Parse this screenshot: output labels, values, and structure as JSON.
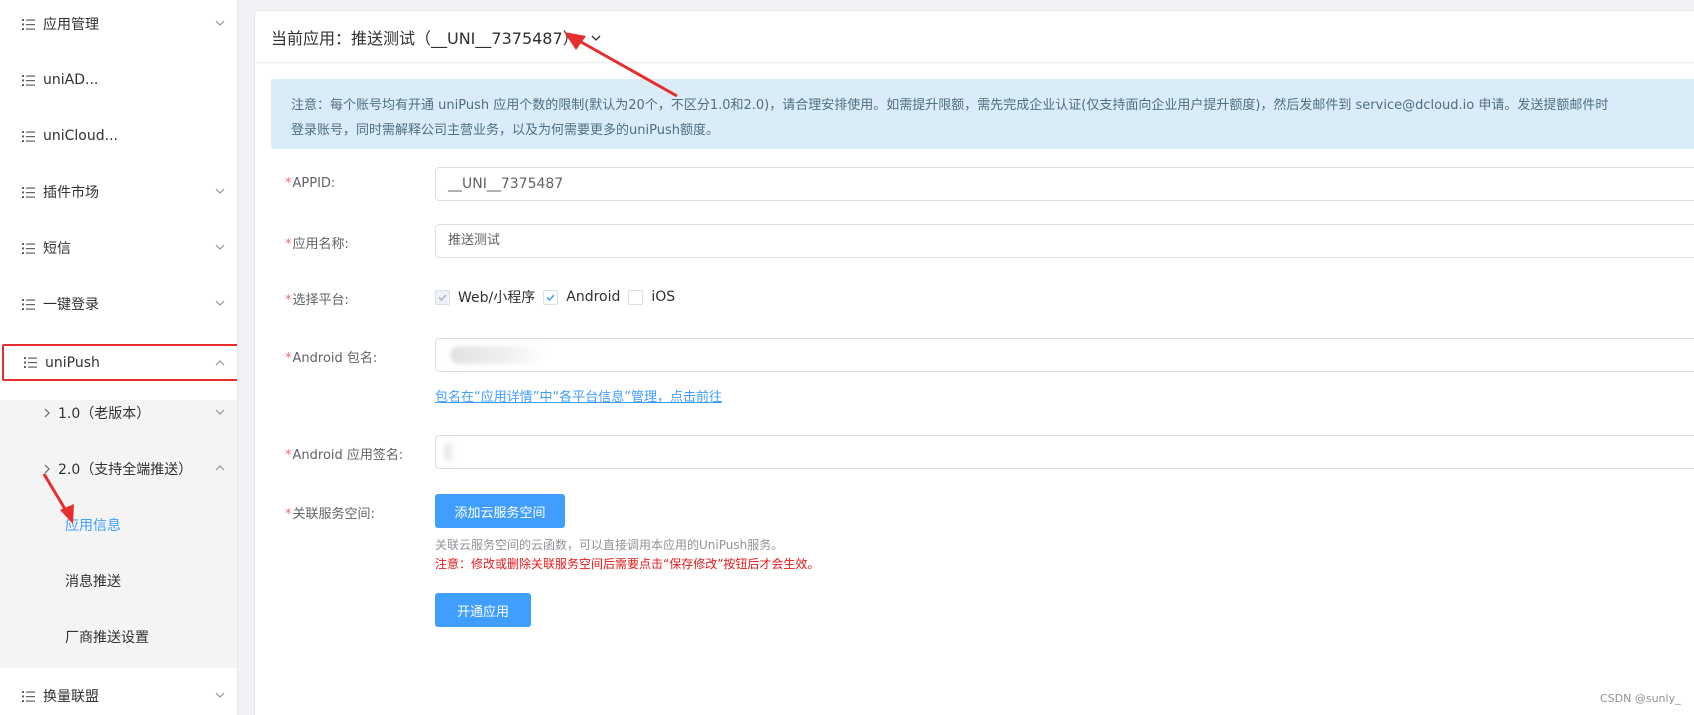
{
  "sidebar": {
    "items": [
      {
        "label": "应用管理"
      },
      {
        "label": "uniAD..."
      },
      {
        "label": "uniCloud..."
      },
      {
        "label": "插件市场"
      },
      {
        "label": "短信"
      },
      {
        "label": "一键登录"
      },
      {
        "label": "uniPush"
      },
      {
        "label": "换量联盟"
      }
    ],
    "subitems": [
      {
        "label": "1.0（老版本）"
      },
      {
        "label": "2.0（支持全端推送）"
      }
    ],
    "leaves": [
      {
        "label": "应用信息"
      },
      {
        "label": "消息推送"
      },
      {
        "label": "厂商推送设置"
      }
    ]
  },
  "header": {
    "title": "当前应用：推送测试（__UNI__7375487）"
  },
  "notice": {
    "line1": "注意：每个账号均有开通 uniPush 应用个数的限制(默认为20个，不区分1.0和2.0)，请合理安排使用。如需提升限额，需先完成企业认证(仅支持面向企业用户提升额度)，然后发邮件到 service@dcloud.io 申请。发送提额邮件时",
    "line2": "登录账号，同时需解释公司主营业务，以及为何需要更多的uniPush额度。"
  },
  "form": {
    "appid_label": "APPID:",
    "appid_value": "__UNI__7375487",
    "name_label": "应用名称:",
    "name_value": "推送测试",
    "platform_label": "选择平台:",
    "platforms": [
      {
        "label": "Web/小程序"
      },
      {
        "label": "Android"
      },
      {
        "label": "iOS"
      }
    ],
    "pkg_label": "Android 包名:",
    "pkg_link": "包名在“应用详情”中“各平台信息”管理，点击前往",
    "sign_label": "Android 应用签名:",
    "space_label": "关联服务空间:",
    "add_space_button": "添加云服务空间",
    "space_hint": "关联云服务空间的云函数，可以直接调用本应用的UniPush服务。",
    "space_warning": "注意：修改或删除关联服务空间后需要点击“保存修改”按钮后才会生效。",
    "open_button": "开通应用",
    "required_mark": "*"
  },
  "watermark": "CSDN @sunly_",
  "colors": {
    "primary": "#409eff",
    "highlight_box": "#e62e2e",
    "notice_bg": "#d9ecf7",
    "warning_text": "#e61a1a"
  }
}
